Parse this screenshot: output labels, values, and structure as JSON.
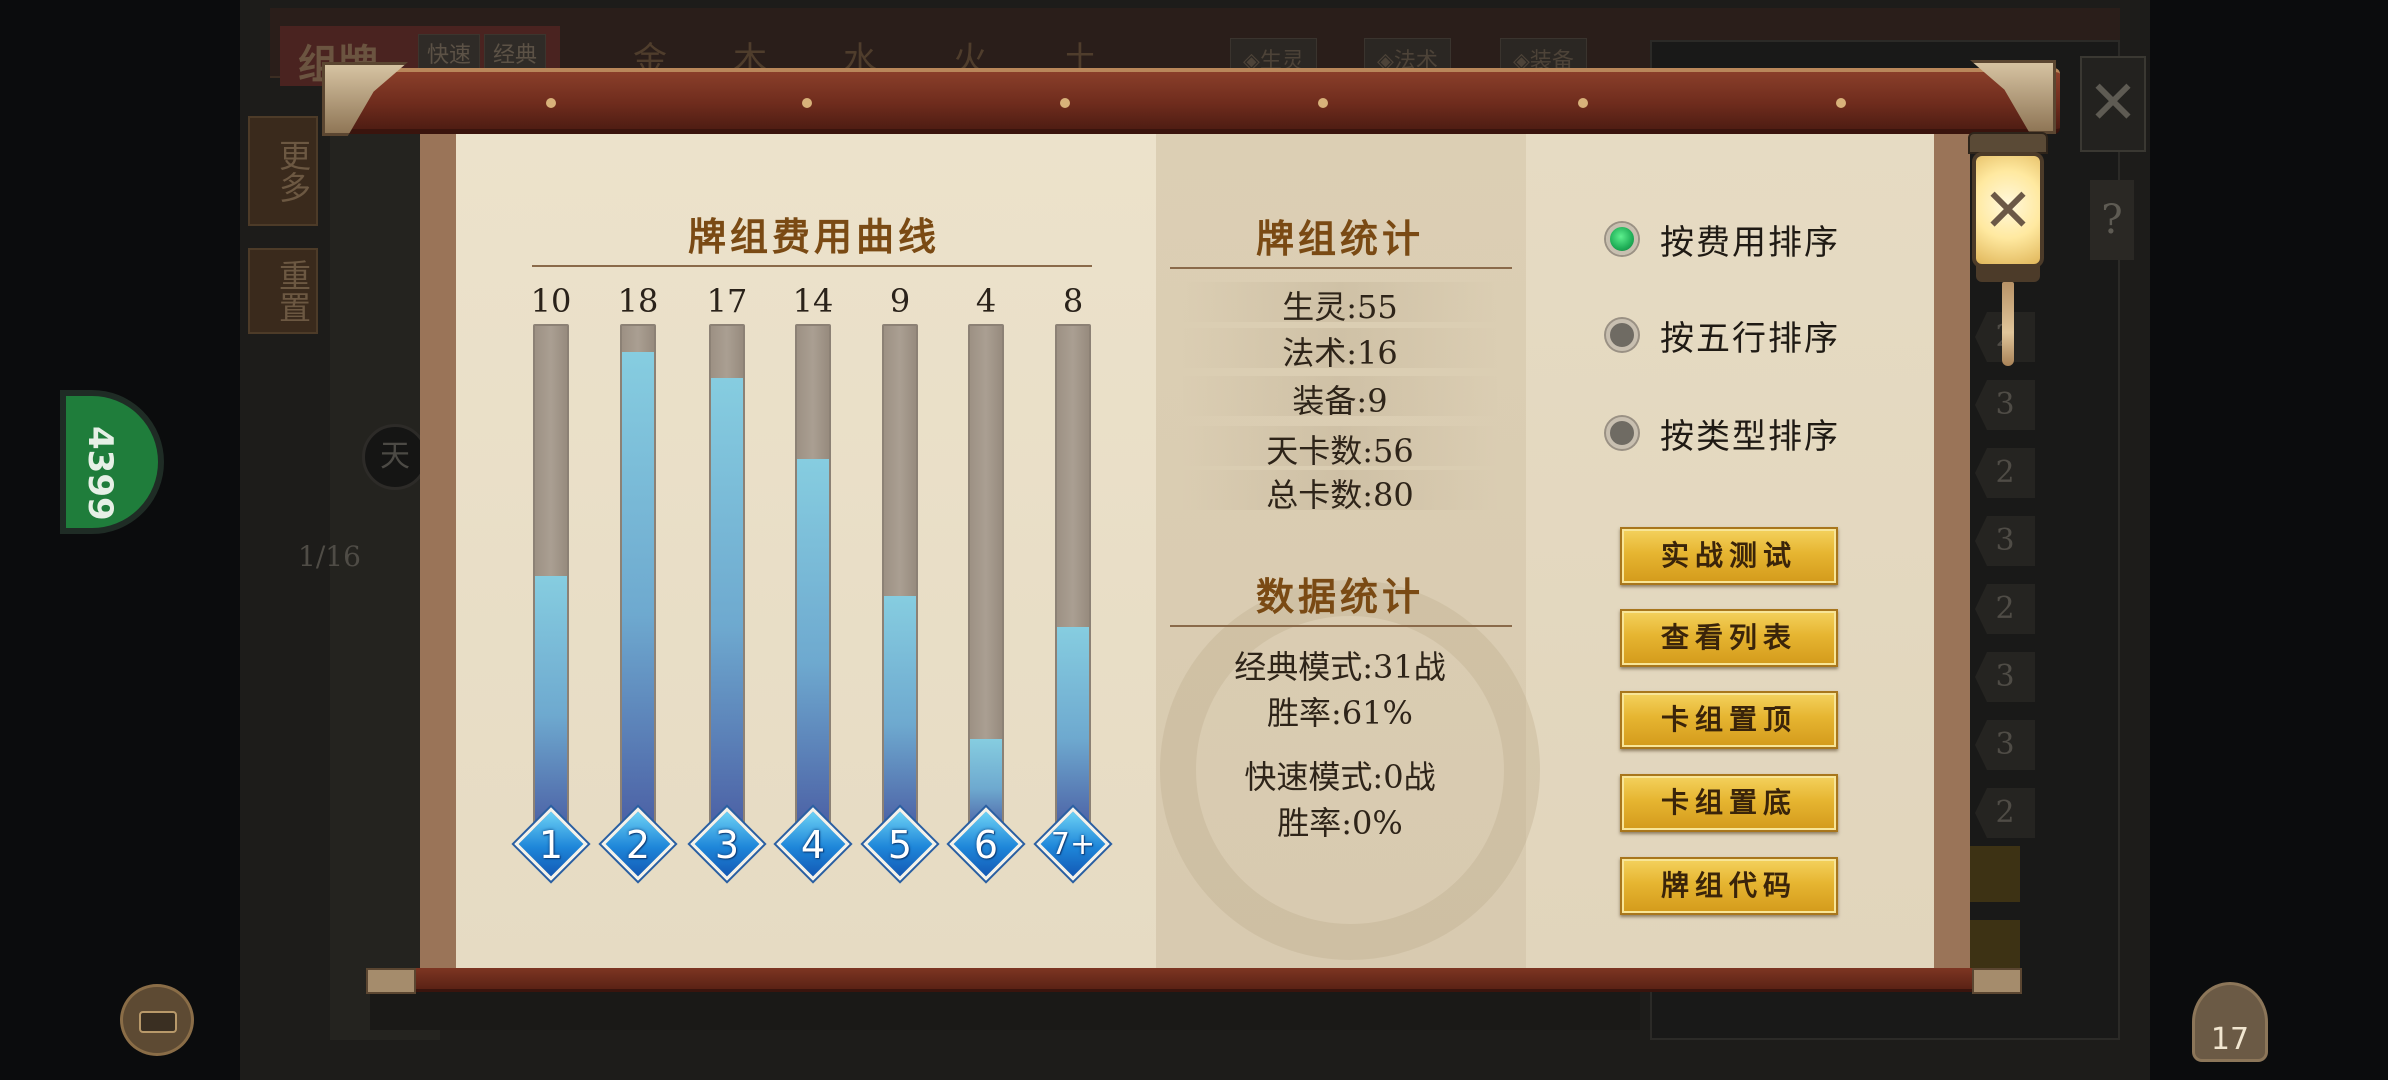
{
  "background": {
    "title": "组牌",
    "mode_tabs": [
      "快速",
      "经典"
    ],
    "element_tabs": [
      "金",
      "木",
      "水",
      "火",
      "土"
    ],
    "filters": [
      "◈生灵",
      "◈法术",
      "◈装备"
    ],
    "side_buttons": [
      "更多",
      "重置"
    ],
    "circle_label": "天",
    "page_indicator": "1/16",
    "green_badge": "4399",
    "right_counts": [
      "2",
      "3",
      "2",
      "3",
      "2",
      "3",
      "3",
      "2"
    ],
    "bag_count": "17"
  },
  "cost_curve": {
    "title": "牌组费用曲线",
    "bars": [
      {
        "cost": "1",
        "count": "10",
        "fill": 0.5
      },
      {
        "cost": "2",
        "count": "18",
        "fill": 0.94
      },
      {
        "cost": "3",
        "count": "17",
        "fill": 0.89
      },
      {
        "cost": "4",
        "count": "14",
        "fill": 0.73
      },
      {
        "cost": "5",
        "count": "9",
        "fill": 0.46
      },
      {
        "cost": "6",
        "count": "4",
        "fill": 0.18
      },
      {
        "cost": "7+",
        "count": "8",
        "fill": 0.4
      }
    ]
  },
  "deck_stats": {
    "title": "牌组统计",
    "lines": [
      "生灵:55",
      "法术:16",
      "装备:9",
      "天卡数:56",
      "总卡数:80"
    ]
  },
  "data_stats": {
    "title": "数据统计",
    "lines": [
      "经典模式:31战",
      "胜率:61%",
      "快速模式:0战",
      "胜率:0%"
    ]
  },
  "sort_options": [
    {
      "label": "按费用排序",
      "selected": true
    },
    {
      "label": "按五行排序",
      "selected": false
    },
    {
      "label": "按类型排序",
      "selected": false
    }
  ],
  "action_buttons": [
    "实战测试",
    "查看列表",
    "卡组置顶",
    "卡组置底",
    "牌组代码"
  ],
  "close_glyph": "✕",
  "colors": {
    "paper": "#e4d9c1",
    "rod": "#6f2c1d",
    "title_brown": "#7a4a14",
    "bar_fill": "#86cde0",
    "gem_blue": "#1e86d9",
    "radio_on": "#1fae57",
    "button_gold": "#e6b531"
  }
}
